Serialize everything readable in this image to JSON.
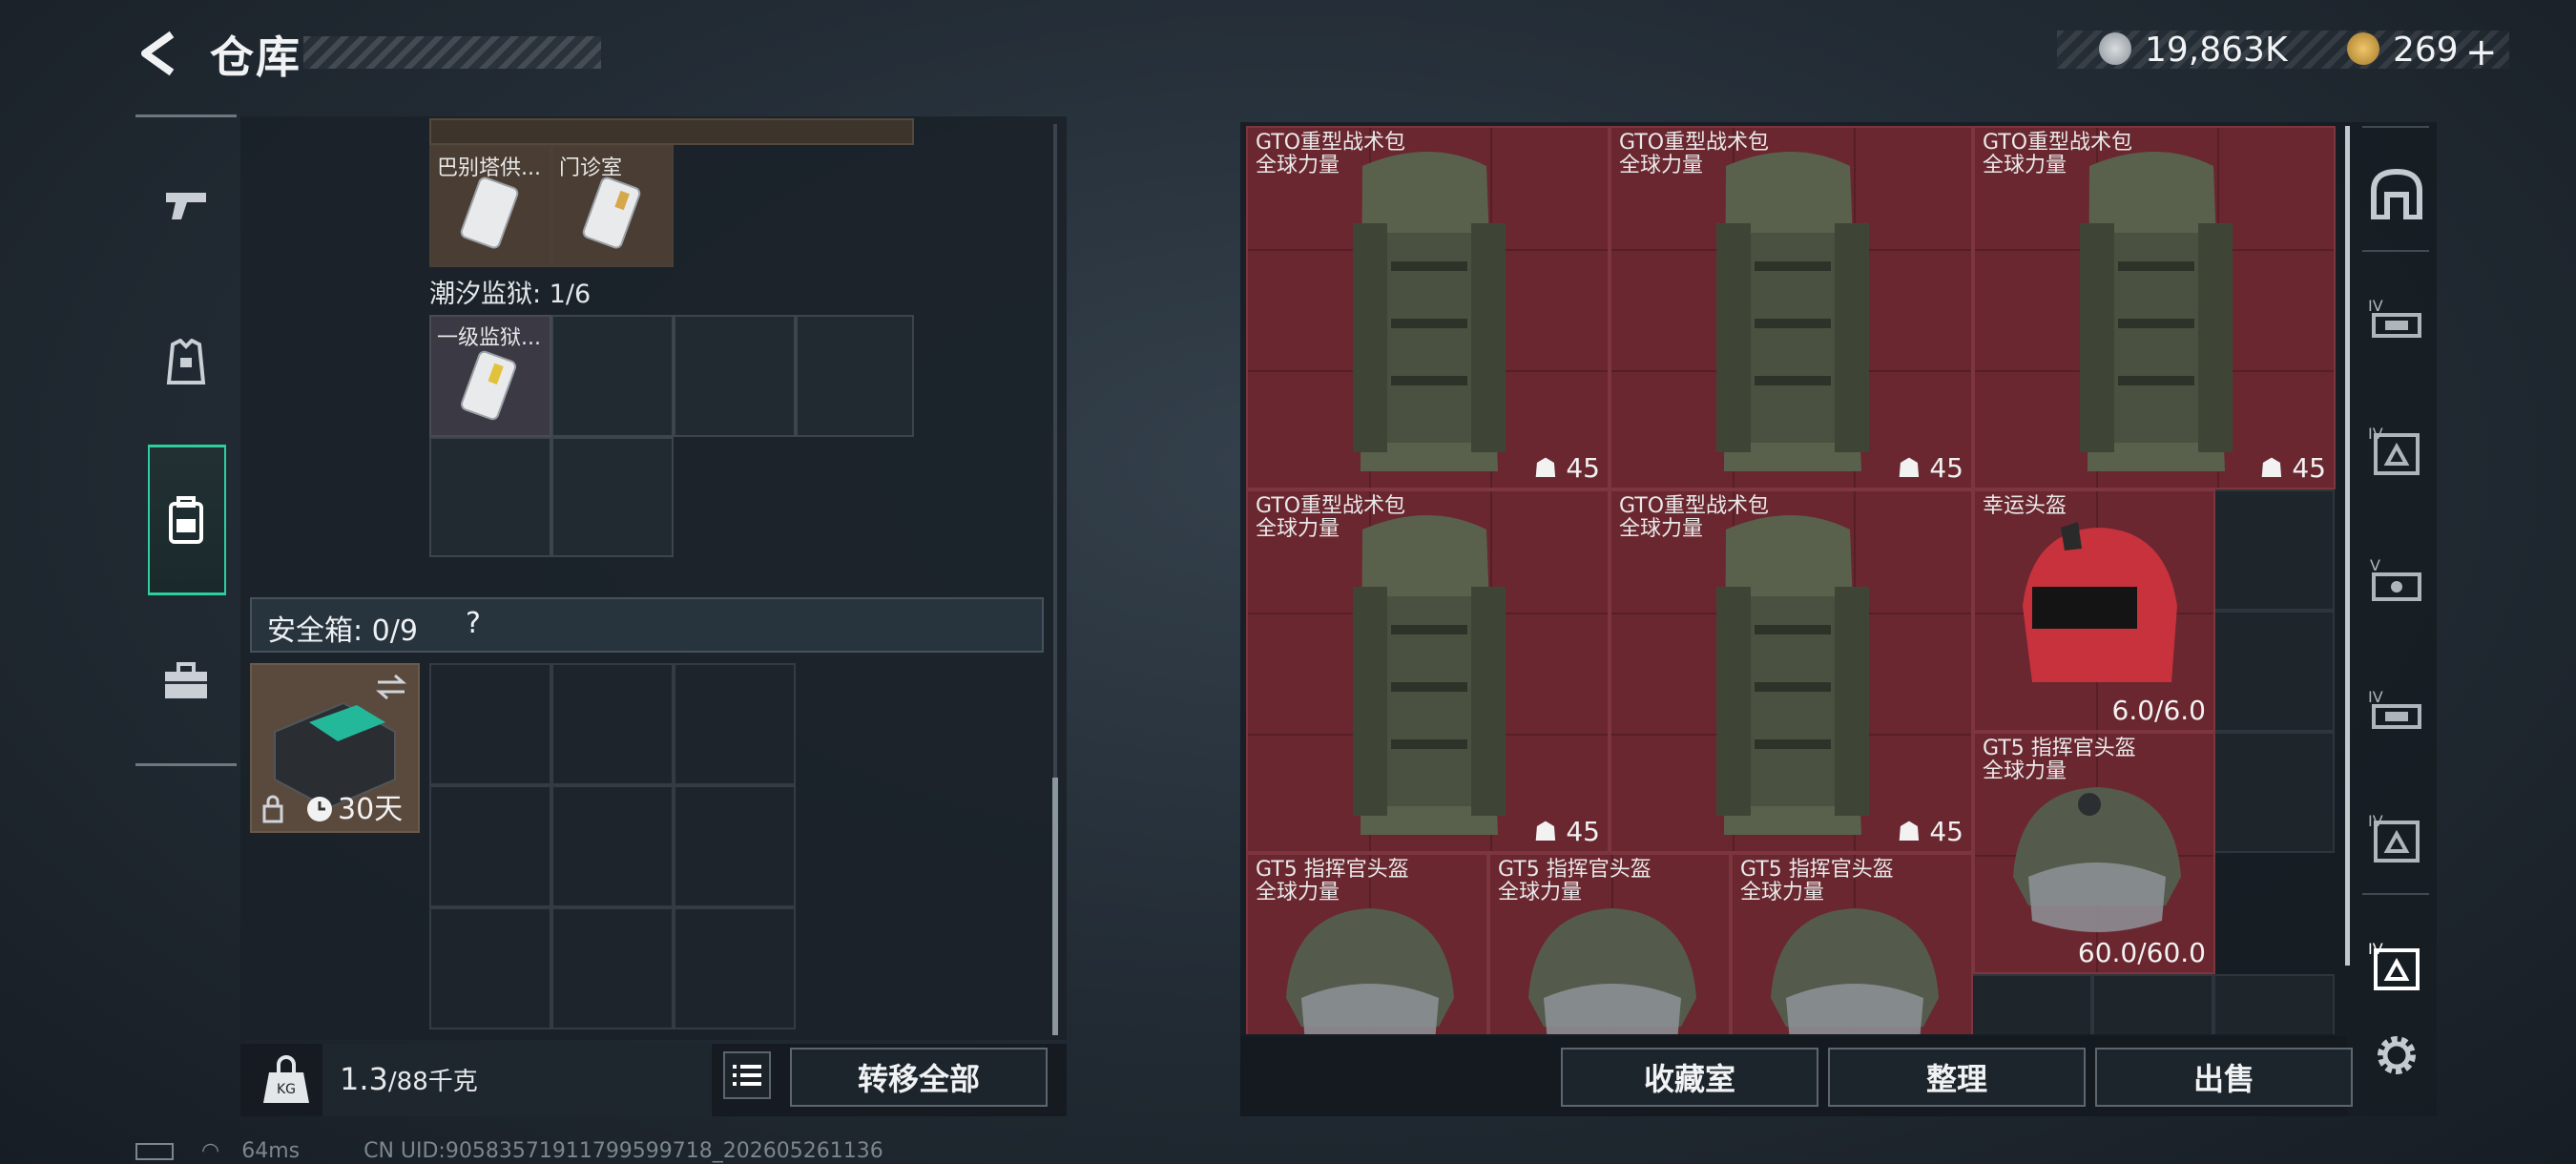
{
  "header": {
    "title": "仓库"
  },
  "currency": {
    "silver": "19,863K",
    "gold": "269"
  },
  "left_tabs": [
    "pistol-icon",
    "armor-vest-icon",
    "backpack-icon",
    "toolbox-icon"
  ],
  "container": {
    "items": [
      {
        "label": "巴别塔供..."
      },
      {
        "label": "门诊室"
      }
    ],
    "prison_section": "潮汐监狱: 1/6",
    "prison_items": [
      {
        "label": "一级监狱..."
      }
    ]
  },
  "safe_box": {
    "label": "安全箱: 0/9",
    "help": "?",
    "duration": "30天"
  },
  "bottom_left": {
    "weight_current": "1.3",
    "weight_max": "/88千克",
    "transfer_all": "转移全部"
  },
  "stash_items": [
    {
      "name": "GTO重型战术包",
      "sub": "全球力量",
      "value": "45"
    },
    {
      "name": "GTO重型战术包",
      "sub": "全球力量",
      "value": "45"
    },
    {
      "name": "GTO重型战术包",
      "sub": "全球力量",
      "value": "45"
    },
    {
      "name": "GTO重型战术包",
      "sub": "全球力量",
      "value": "45"
    },
    {
      "name": "GTO重型战术包",
      "sub": "全球力量",
      "value": "45"
    },
    {
      "name": "幸运头盔",
      "sub": "",
      "value": "6.0/6.0"
    },
    {
      "name": "GT5 指挥官头盔",
      "sub": "全球力量",
      "value": "60.0/60.0"
    },
    {
      "name": "GT5 指挥官头盔",
      "sub": "全球力量",
      "value": ""
    },
    {
      "name": "GT5 指挥官头盔",
      "sub": "全球力量",
      "value": ""
    },
    {
      "name": "GT5 指挥官头盔",
      "sub": "全球力量",
      "value": ""
    }
  ],
  "right_buttons": {
    "collection": "收藏室",
    "organize": "整理",
    "sell": "出售"
  },
  "right_side_icons": [
    "safehouse-icon",
    "tier-iv-storage-icon",
    "tier-iv-storage-icon",
    "tier-v-storage-icon",
    "tier-iv-storage-icon",
    "tier-iv-storage-icon",
    "tier-iv-storage-icon",
    "settings-icon"
  ],
  "footer": {
    "ping": "64ms",
    "uid": "CN UID:9058357191179959​9718_202605261136"
  },
  "colors": {
    "accent": "#2dcf9f",
    "item_red": "#6a2730",
    "panel": "#1a2128"
  }
}
